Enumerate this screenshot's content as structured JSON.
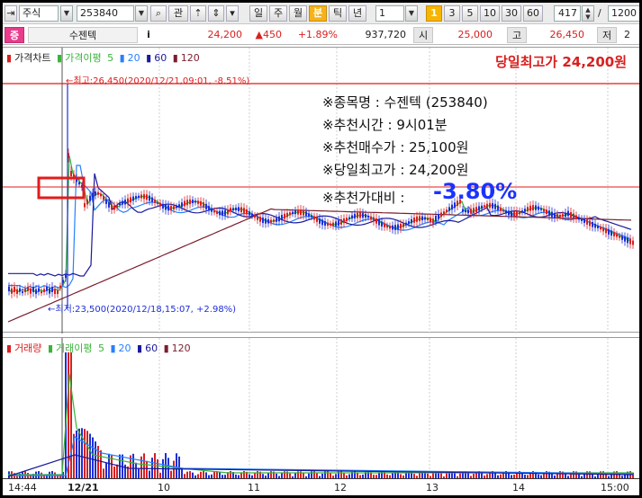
{
  "toolbar": {
    "market": "주식",
    "code": "253840",
    "gwan": "관",
    "periods": [
      "일",
      "주",
      "월",
      "분",
      "틱",
      "년"
    ],
    "interval_value": "1",
    "minute_options": [
      "1",
      "3",
      "5",
      "10",
      "30",
      "60"
    ],
    "count": "417",
    "slash": "/",
    "total": "1200"
  },
  "quote": {
    "badge": "증",
    "name": "수젠텍",
    "info": "i",
    "price": "24,200",
    "change": "▲450",
    "rate": "+1.89%",
    "volume": "937,720",
    "open_label": "시",
    "open": "25,000",
    "high_label": "고",
    "high": "26,450",
    "low_label": "저",
    "low_trunc": "2"
  },
  "price_chart": {
    "legend": {
      "main": "가격차트",
      "ma": "가격이평",
      "p1": "5",
      "p2": "20",
      "p3": "60",
      "p4": "120"
    },
    "headline": "당일최고가 24,200원",
    "max_label": "←최고:26,450(2020/12/21,09:01, -8.51%)",
    "min_label": "←최저:23,500(2020/12/18,15:07, +2.98%)",
    "info_lines": [
      "※종목명 : 수젠텍 (253840)",
      "※추천시간 : 9시01분",
      "※추천매수가 : 25,100원",
      "※당일최고가 : 24,200원"
    ],
    "ratio_label": "※추천가대비 :",
    "ratio_value": "-3.80%"
  },
  "volume_chart": {
    "legend": {
      "main": "거래량",
      "ma": "거래이평",
      "p1": "5",
      "p2": "20",
      "p3": "60",
      "p4": "120"
    }
  },
  "xaxis": {
    "labels": [
      "14:44",
      "12/21",
      "10",
      "11",
      "12",
      "13",
      "14",
      "15:00"
    ]
  },
  "colors": {
    "up": "#d9201f",
    "down": "#1d2fd6",
    "ma5": "#3bb33b",
    "ma20": "#2680ff",
    "ma60": "#1a1a9c",
    "ma120": "#7a1e2d",
    "accent": "#1a33ff"
  }
}
